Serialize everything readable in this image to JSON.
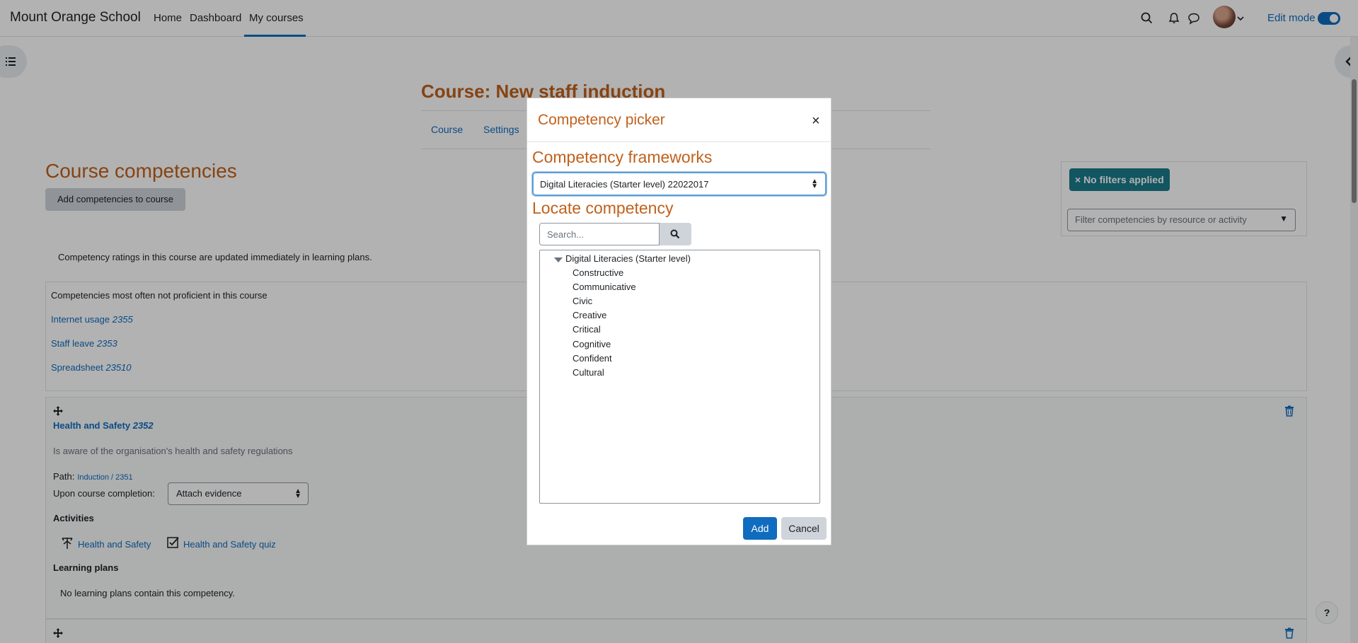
{
  "navbar": {
    "site_name": "Mount Orange School",
    "links": [
      "Home",
      "Dashboard",
      "My courses"
    ],
    "edit_mode_label": "Edit mode"
  },
  "course": {
    "title": "Course: New staff induction",
    "tabs": [
      "Course",
      "Settings"
    ]
  },
  "page": {
    "heading": "Course competencies",
    "add_button": "Add competencies to course",
    "info_text": "Competency ratings in this course are updated immediately in learning plans."
  },
  "filters": {
    "badge": "× No filters applied",
    "placeholder": "Filter competencies by resource or activity"
  },
  "stats": {
    "title": "Competencies most often not proficient in this course",
    "items": [
      {
        "name": "Internet usage",
        "id": "2355"
      },
      {
        "name": "Staff leave",
        "id": "2353"
      },
      {
        "name": "Spreadsheet",
        "id": "23510"
      }
    ]
  },
  "competency": {
    "name": "Health and Safety",
    "id": "2352",
    "description": "Is aware of the organisation's health and safety regulations",
    "path_label": "Path:",
    "path_value": "Induction / 2351",
    "upon_label": "Upon course completion:",
    "upon_value": "Attach evidence",
    "activities_label": "Activities",
    "activities": [
      "Health and Safety",
      "Health and Safety quiz"
    ],
    "learning_plans_label": "Learning plans",
    "learning_plans_text": "No learning plans contain this competency."
  },
  "help_label": "?",
  "modal": {
    "title": "Competency picker",
    "close": "×",
    "frameworks_heading": "Competency frameworks",
    "framework_selected": "Digital Literacies (Starter level) 22022017",
    "locate_heading": "Locate competency",
    "search_placeholder": "Search...",
    "tree_root": "Digital Literacies (Starter level)",
    "tree_items": [
      "Constructive",
      "Communicative",
      "Civic",
      "Creative",
      "Critical",
      "Cognitive",
      "Confident",
      "Cultural"
    ],
    "add_button": "Add",
    "cancel_button": "Cancel"
  }
}
